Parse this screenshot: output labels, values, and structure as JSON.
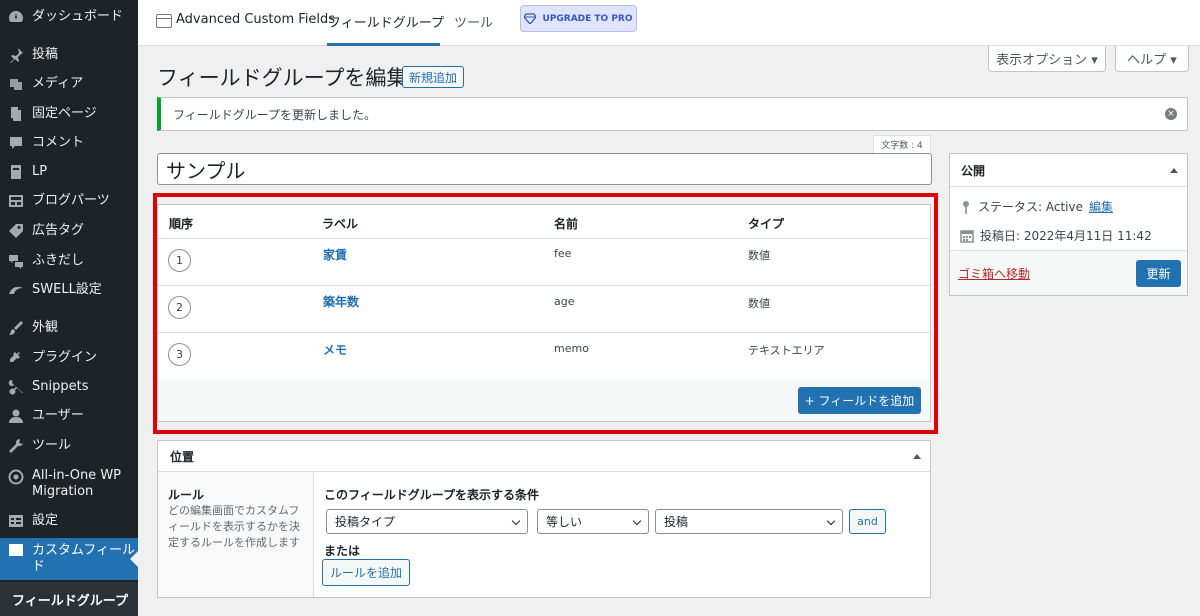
{
  "sidebar": {
    "items": [
      {
        "icon": "dashboard-icon",
        "label": "ダッシュボード"
      },
      {
        "icon": "pin-icon",
        "label": "投稿"
      },
      {
        "icon": "media-icon",
        "label": "メディア"
      },
      {
        "icon": "page-icon",
        "label": "固定ページ"
      },
      {
        "icon": "comment-icon",
        "label": "コメント"
      },
      {
        "icon": "lp-icon",
        "label": "LP"
      },
      {
        "icon": "blog-parts-icon",
        "label": "ブログパーツ"
      },
      {
        "icon": "ad-tag-icon",
        "label": "広告タグ"
      },
      {
        "icon": "balloon-icon",
        "label": "ふきだし"
      },
      {
        "icon": "swell-icon",
        "label": "SWELL設定"
      },
      {
        "icon": "appearance-icon",
        "label": "外観"
      },
      {
        "icon": "plugin-icon",
        "label": "プラグイン"
      },
      {
        "icon": "snippets-icon",
        "label": "Snippets"
      },
      {
        "icon": "user-icon",
        "label": "ユーザー"
      },
      {
        "icon": "tools-icon",
        "label": "ツール"
      },
      {
        "icon": "migration-icon",
        "label": "All-in-One WP Migration"
      },
      {
        "icon": "settings-icon",
        "label": "設定"
      },
      {
        "icon": "custom-fields-icon",
        "label": "カスタムフィールド"
      }
    ],
    "submenu_label": "フィールドグループ"
  },
  "topbar": {
    "brand": "Advanced Custom Fields",
    "tabs": [
      {
        "label": "フィールドグループ",
        "active": true
      },
      {
        "label": "ツール",
        "active": false
      }
    ],
    "upgrade_label": "UPGRADE TO PRO"
  },
  "screen_options": {
    "display_label": "表示オプション ▾",
    "help_label": "ヘルプ ▾"
  },
  "page": {
    "title": "フィールドグループを編集",
    "new_button": "新規追加"
  },
  "notice": {
    "text": "フィールドグループを更新しました。",
    "close": "×"
  },
  "editor": {
    "char_count": "文字数 : 4",
    "title_value": "サンプル"
  },
  "fields_table": {
    "headers": {
      "order": "順序",
      "label": "ラベル",
      "name": "名前",
      "type": "タイプ"
    },
    "rows": [
      {
        "order": "1",
        "label": "家賃",
        "name": "fee",
        "type": "数値"
      },
      {
        "order": "2",
        "label": "築年数",
        "name": "age",
        "type": "数値"
      },
      {
        "order": "3",
        "label": "メモ",
        "name": "memo",
        "type": "テキストエリア"
      }
    ],
    "add_button": "+ フィールドを追加"
  },
  "location": {
    "title": "位置",
    "rule_title": "ルール",
    "rule_desc": "どの編集画面でカスタムフィールドを表示するかを決定するルールを作成します",
    "condition_title": "このフィールドグループを表示する条件",
    "param_select": "投稿タイプ",
    "operator_select": "等しい",
    "value_select": "投稿",
    "and_button": "and",
    "or_label": "または",
    "add_rule_button": "ルールを追加"
  },
  "publish": {
    "title": "公開",
    "status_prefix": "ステータス: Active",
    "status_edit": "編集",
    "date_text": "投稿日: 2022年4月11日 11:42",
    "trash_link": "ゴミ箱へ移動",
    "update_button": "更新"
  },
  "colors": {
    "admin_bar": "#1d2327",
    "accent": "#2271b1",
    "highlight_outline": "#e00000",
    "success": "#00a32a"
  }
}
